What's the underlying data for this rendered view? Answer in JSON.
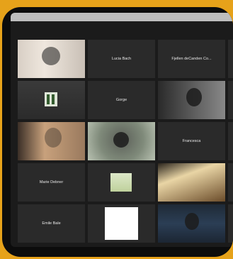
{
  "participants": [
    {
      "name": "",
      "type": "video"
    },
    {
      "name": "Lucia Bach",
      "type": "name"
    },
    {
      "name": "Fjellen deCanden Co...",
      "type": "name"
    },
    {
      "name": "",
      "type": "video"
    },
    {
      "name": "Gorge",
      "type": "name"
    },
    {
      "name": "",
      "type": "video"
    },
    {
      "name": "",
      "type": "video"
    },
    {
      "name": "",
      "type": "video",
      "active": true
    },
    {
      "name": "Francesca",
      "type": "name"
    },
    {
      "name": "Marie Debner",
      "type": "name"
    },
    {
      "name": "",
      "type": "video"
    },
    {
      "name": "",
      "type": "video"
    },
    {
      "name": "Emile Bale",
      "type": "name"
    },
    {
      "name": "",
      "type": "video"
    },
    {
      "name": "",
      "type": "video"
    }
  ]
}
